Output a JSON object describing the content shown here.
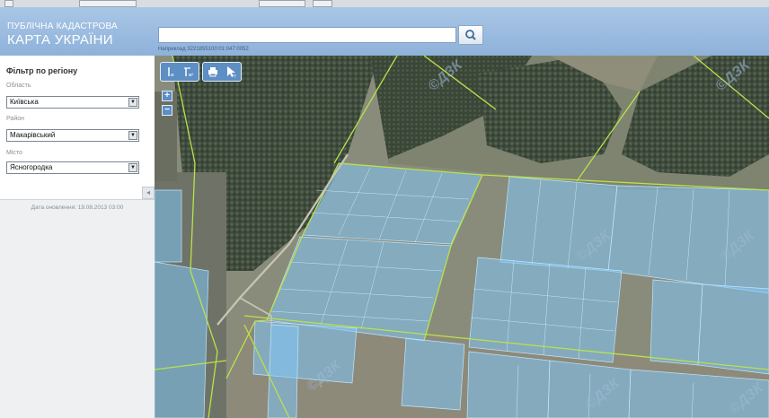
{
  "header": {
    "logo_line1": "ПУБЛІЧНА КАДАСТРОВА",
    "logo_line2": "КАРТА УКРАЇНИ",
    "search_value": "",
    "search_hint": "Наприклад 3221855100:01:047:0052"
  },
  "sidebar": {
    "filter_title": "Фільтр по регіону",
    "oblast_label": "Область",
    "oblast_value": "Київська",
    "raion_label": "Район",
    "raion_value": "Макарівський",
    "misto_label": "Місто",
    "misto_value": "Ясногородка",
    "collapse_glyph": "◂",
    "updated_text": "Дата оновлення: 19.08.2013 03:00"
  },
  "map": {
    "zoom_in": "+",
    "zoom_out": "−",
    "watermark": "©ДЗК",
    "parcel_fill": "#7fc4f5",
    "boundary_color": "#b9e24a"
  },
  "colors": {
    "header": "#9bbbe0",
    "accent": "#5d8ec4"
  }
}
